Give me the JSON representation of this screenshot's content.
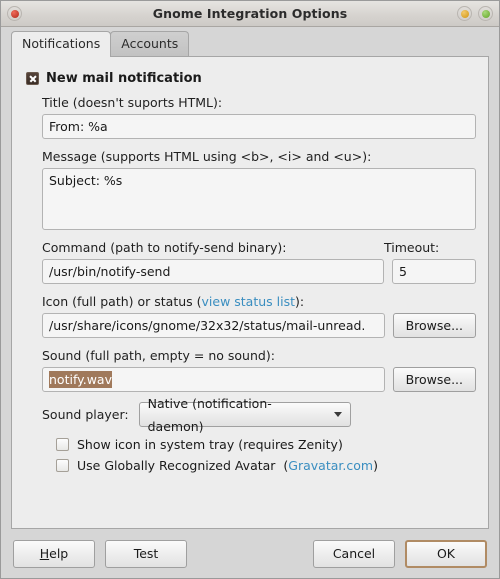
{
  "window": {
    "title": "Gnome Integration Options",
    "controls": {
      "close": "close-button",
      "minimize": "minimize-button",
      "maximize": "maximize-button"
    }
  },
  "tabs": [
    {
      "label": "Notifications",
      "active": true
    },
    {
      "label": "Accounts",
      "active": false
    }
  ],
  "notifications": {
    "group": {
      "label": "New mail notification",
      "checked": true
    },
    "title_field": {
      "label": "Title (doesn't suports HTML):",
      "value": "From: %a"
    },
    "message_field": {
      "label": "Message (supports HTML using <b>, <i> and <u>):",
      "value": "Subject: %s"
    },
    "command_field": {
      "label": "Command (path to notify-send binary):",
      "value": "/usr/bin/notify-send"
    },
    "timeout_field": {
      "label": "Timeout:",
      "value": "5"
    },
    "icon_field": {
      "label_prefix": "Icon (full path) or status (",
      "label_link": "view status list",
      "label_suffix": "):",
      "value": "/usr/share/icons/gnome/32x32/status/mail-unread.",
      "browse_label": "Browse..."
    },
    "sound_field": {
      "label": "Sound (full path, empty = no sound):",
      "value": "notify.wav",
      "selected": true,
      "browse_label": "Browse..."
    },
    "sound_player": {
      "label": "Sound player:",
      "value": "Native (notification-daemon)"
    },
    "tray_checkbox": {
      "label": "Show icon in system tray (requires Zenity)",
      "checked": false
    },
    "gravatar_checkbox": {
      "label_prefix": "Use Globally Recognized Avatar",
      "label_open": "(",
      "label_link": "Gravatar.com",
      "label_close": ")",
      "checked": false
    }
  },
  "actions": {
    "help": {
      "mnemonic": "H",
      "rest": "elp"
    },
    "test": "Test",
    "cancel": "Cancel",
    "ok": "OK"
  },
  "colors": {
    "link": "#3a8ec0",
    "selection": "#a0795b",
    "focus_ring": "#b08b64",
    "dialog_bg": "#d6d6d6",
    "panel_bg": "#ededed"
  }
}
